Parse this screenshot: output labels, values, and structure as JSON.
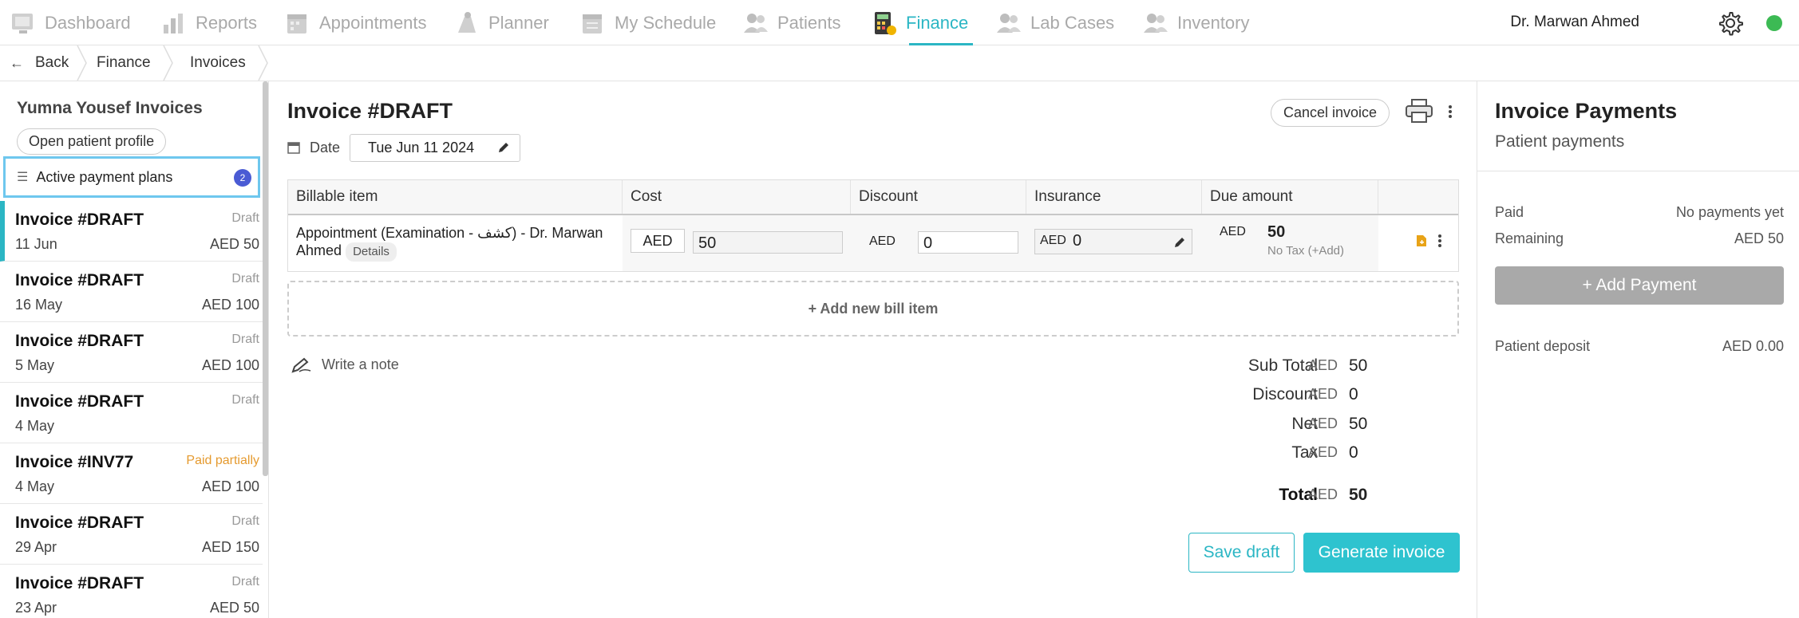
{
  "nav": {
    "items": [
      {
        "label": "Dashboard",
        "icon": "dashboard-icon"
      },
      {
        "label": "Reports",
        "icon": "reports-icon"
      },
      {
        "label": "Appointments",
        "icon": "appointments-icon"
      },
      {
        "label": "Planner",
        "icon": "planner-icon"
      },
      {
        "label": "My Schedule",
        "icon": "schedule-icon"
      },
      {
        "label": "Patients",
        "icon": "patients-icon"
      },
      {
        "label": "Finance",
        "icon": "finance-icon"
      },
      {
        "label": "Lab Cases",
        "icon": "lab-cases-icon"
      },
      {
        "label": "Inventory",
        "icon": "inventory-icon"
      }
    ],
    "active": "Finance",
    "user_name": "Dr. Marwan Ahmed",
    "accent": "#2bb6c4",
    "status_color": "#3cba54"
  },
  "breadcrumb": {
    "back": "Back",
    "items": [
      "Finance",
      "Invoices"
    ]
  },
  "sidebar": {
    "title": "Yumna Yousef Invoices",
    "open_profile": "Open patient profile",
    "payment_plans": "Active payment plans",
    "payment_plans_count": "2",
    "invoices": [
      {
        "title": "Invoice #DRAFT",
        "status": "Draft",
        "date": "11 Jun",
        "amount": "AED 50"
      },
      {
        "title": "Invoice #DRAFT",
        "status": "Draft",
        "date": "16 May",
        "amount": "AED 100"
      },
      {
        "title": "Invoice #DRAFT",
        "status": "Draft",
        "date": "5 May",
        "amount": "AED 100"
      },
      {
        "title": "Invoice #DRAFT",
        "status": "Draft",
        "date": "4 May",
        "amount": ""
      },
      {
        "title": "Invoice #INV77",
        "status": "Paid partially",
        "date": "4 May",
        "amount": "AED 100"
      },
      {
        "title": "Invoice #DRAFT",
        "status": "Draft",
        "date": "29 Apr",
        "amount": "AED 150"
      },
      {
        "title": "Invoice #DRAFT",
        "status": "Draft",
        "date": "23 Apr",
        "amount": "AED 50"
      }
    ]
  },
  "invoice": {
    "title": "Invoice #DRAFT",
    "cancel": "Cancel invoice",
    "date_label": "Date",
    "date_value": "Tue Jun 11 2024",
    "columns": [
      "Billable item",
      "Cost",
      "Discount",
      "Insurance",
      "Due amount"
    ],
    "row": {
      "item_line1": "Appointment (Examination - كشف) - Dr. Marwan",
      "item_line2": "Ahmed",
      "details": "Details",
      "cost_currency": "AED",
      "cost_value": "50",
      "discount_currency": "AED",
      "discount_value": "0",
      "insurance_currency": "AED",
      "insurance_value": "0",
      "due_currency": "AED",
      "due_value": "50",
      "tax_note": "No Tax (+Add)"
    },
    "add_bill_item": "+ Add new bill item",
    "write_note": "Write a note",
    "totals": {
      "currency": "AED",
      "sub_total_label": "Sub Total",
      "sub_total": "50",
      "discount_label": "Discount",
      "discount": "0",
      "net_label": "Net",
      "net": "50",
      "tax_label": "Tax",
      "tax": "0",
      "total_label": "Total",
      "total": "50"
    },
    "save_draft": "Save draft",
    "generate": "Generate invoice"
  },
  "payments": {
    "title": "Invoice Payments",
    "subtitle": "Patient payments",
    "paid_label": "Paid",
    "paid_value": "No payments yet",
    "remaining_label": "Remaining",
    "remaining_value": "AED 50",
    "add_payment": "+ Add Payment",
    "deposit_label": "Patient deposit",
    "deposit_value": "AED 0.00"
  }
}
